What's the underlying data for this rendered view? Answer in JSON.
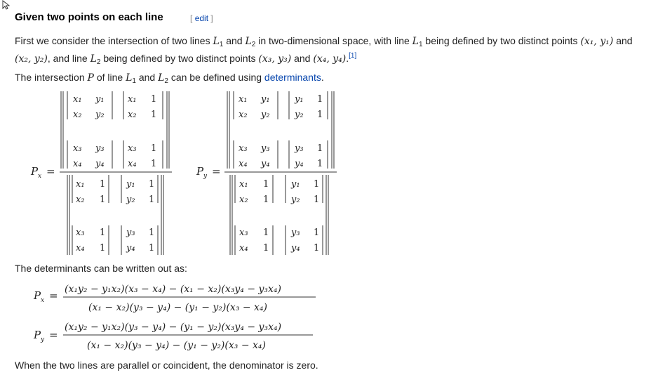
{
  "section": {
    "title": "Given two points on each line",
    "edit_bracket_open": "[",
    "edit_label": "edit",
    "edit_bracket_close": "]"
  },
  "paragraphs": {
    "p1_a": "First we consider the intersection of two lines",
    "p1_and": "and",
    "p1_b": "in two-dimensional space, with line",
    "p1_c": "being defined by two distinct points",
    "p1_and2": "and",
    "p2_a": ", and line",
    "p2_b": "being defined by two distinct points",
    "p2_and": "and",
    "p2_ref": "[1]",
    "p3_a": "The intersection",
    "p3_b": "of line",
    "p3_and": "and",
    "p3_c": "can be defined using",
    "p3_link": "determinants",
    "p4": "The determinants can be written out as:",
    "p5": "When the two lines are parallel or coincident, the denominator is zero."
  },
  "math": {
    "L1": "L",
    "L2": "L",
    "sub1": "1",
    "sub2": "2",
    "P": "P",
    "pt1": "(x₁, y₁)",
    "pt2": "(x₂, y₂)",
    "pt3": "(x₃, y₃)",
    "pt4": "(x₄, y₄)",
    "Px": "P",
    "Py": "P",
    "eq": "=",
    "px_num": "(x₁y₂ − y₁x₂)(x₃ − x₄) − (x₁ − x₂)(x₃y₄ − y₃x₄)",
    "py_num": "(x₁y₂ − y₁x₂)(y₃ − y₄) − (y₁ − y₂)(x₃y₄ − y₃x₄)",
    "den": "(x₁ − x₂)(y₃ − y₄) − (y₁ − y₂)(x₃ − x₄)",
    "x1": "x₁",
    "x2": "x₂",
    "x3": "x₃",
    "x4": "x₄",
    "y1": "y₁",
    "y2": "y₂",
    "y3": "y₃",
    "y4": "y₄",
    "one": "1",
    "sub_x": "x",
    "sub_y": "y"
  }
}
